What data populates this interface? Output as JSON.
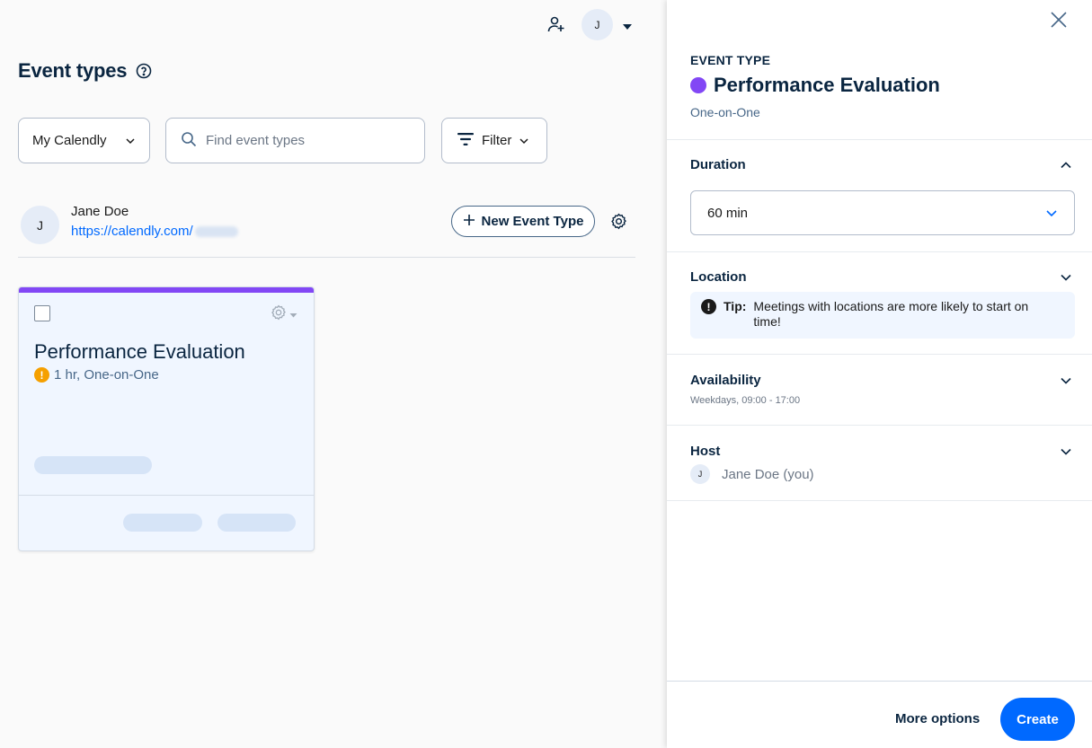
{
  "topbar": {
    "avatar_initial": "J",
    "add_user_icon": "add-user-icon",
    "caret_icon": "caret-down-icon"
  },
  "main": {
    "title": "Event types",
    "calendly_select": "My Calendly",
    "search": {
      "placeholder": "Find event types",
      "value": ""
    },
    "filter_label": "Filter",
    "user": {
      "initial": "J",
      "name": "Jane Doe",
      "url": "https://calendly.com/"
    },
    "new_event_type_label": "New Event Type",
    "cards": [
      {
        "title": "Performance Evaluation",
        "subtitle": "1 hr, One-on-One",
        "color": "#8247f5"
      }
    ]
  },
  "drawer": {
    "label": "EVENT TYPE",
    "title": "Performance Evaluation",
    "color": "#8247f5",
    "kind": "One-on-One",
    "duration": {
      "title": "Duration",
      "value": "60 min"
    },
    "location": {
      "title": "Location",
      "tip_label": "Tip:",
      "tip_text": "Meetings with locations are more likely to start on time!"
    },
    "availability": {
      "title": "Availability",
      "summary": "Weekdays, 09:00 - 17:00"
    },
    "host": {
      "title": "Host",
      "initial": "J",
      "name": "Jane Doe (you)"
    },
    "more_options_label": "More options",
    "create_label": "Create"
  },
  "colors": {
    "accent": "#0069ff",
    "purple": "#8247f5",
    "warning": "#f5a000",
    "navy": "#0a2540"
  }
}
